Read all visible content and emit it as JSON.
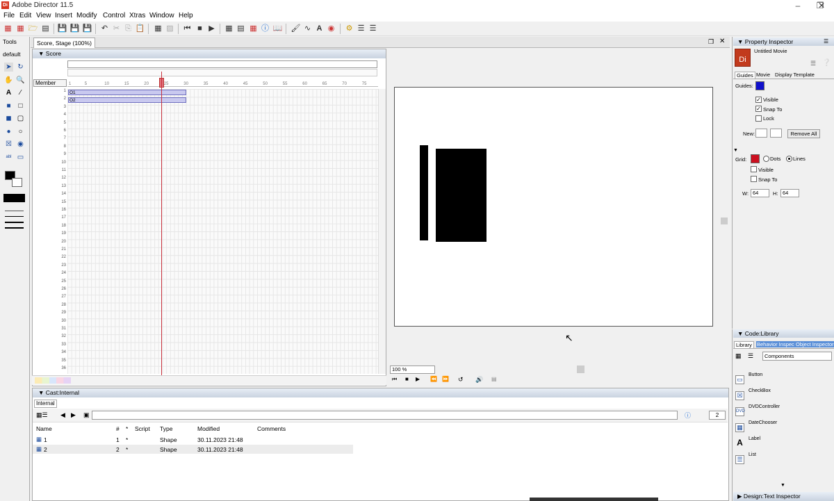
{
  "window": {
    "title": "Adobe Director 11.5",
    "icon": "Di"
  },
  "menu": [
    "File",
    "Edit",
    "View",
    "Insert",
    "Modify",
    "Control",
    "Xtras",
    "Window",
    "Help"
  ],
  "tools_panel": {
    "title": "Tools",
    "mode": "default"
  },
  "document_tab": "Score, Stage (100%)",
  "score": {
    "title": "Score",
    "column_header": "Member",
    "frame_ticks": [
      "1",
      "5",
      "10",
      "15",
      "20",
      "25",
      "30",
      "35",
      "40",
      "45",
      "50",
      "55",
      "60",
      "65",
      "70",
      "75"
    ],
    "channels": [
      "1",
      "2",
      "3",
      "4",
      "5",
      "6",
      "7",
      "8",
      "9",
      "10",
      "11",
      "12",
      "13",
      "14",
      "15",
      "16",
      "17",
      "18",
      "19",
      "20",
      "21",
      "22",
      "23",
      "24",
      "25",
      "26",
      "27",
      "28",
      "29",
      "30",
      "31",
      "32",
      "33",
      "34",
      "35",
      "36"
    ],
    "sprites": [
      {
        "channel": "1",
        "label": "O1"
      },
      {
        "channel": "2",
        "label": "O2"
      }
    ],
    "playhead_frame": 25
  },
  "stage": {
    "zoom": "100 %",
    "controls": [
      "rewind-icon",
      "stop-icon",
      "play-icon",
      "step-back-icon",
      "step-forward-icon",
      "loop-icon",
      "volume-icon",
      "dvd-icon"
    ]
  },
  "cast": {
    "title": "Cast:Internal",
    "tab": "Internal",
    "count": "2",
    "columns": [
      "Name",
      "#",
      "*",
      "Script",
      "Type",
      "Modified",
      "Comments"
    ],
    "rows": [
      {
        "name": "1",
        "num": "1",
        "star": "*",
        "script": "",
        "type": "Shape",
        "modified": "30.11.2023 21:48",
        "comments": ""
      },
      {
        "name": "2",
        "num": "2",
        "star": "*",
        "script": "",
        "type": "Shape",
        "modified": "30.11.2023 21:48",
        "comments": ""
      }
    ]
  },
  "property_inspector": {
    "title": "Property Inspector",
    "movie_name": "Untitled Movie",
    "tabs": [
      "Guides",
      "Movie",
      "Display Template"
    ],
    "guides_label": "Guides:",
    "guides_color": "#1010cc",
    "guide_visible": "Visible",
    "guide_snap": "Snap To",
    "guide_lock": "Lock",
    "new_label": "New:",
    "remove_all": "Remove All",
    "grid_label": "Grid:",
    "grid_color": "#cc1020",
    "dots": "Dots",
    "lines": "Lines",
    "grid_visible": "Visible",
    "grid_snap": "Snap To",
    "w_label": "W:",
    "w_value": "64",
    "h_label": "H:",
    "h_value": "64"
  },
  "library": {
    "title": "Code:Library",
    "tabs": [
      "Library",
      "Behavior Inspec",
      "Object Inspector"
    ],
    "dropdown": "Components",
    "items": [
      "Button",
      "CheckBox",
      "DVDController",
      "DateChooser",
      "Label",
      "List"
    ],
    "footer": "Design:Text Inspector"
  }
}
